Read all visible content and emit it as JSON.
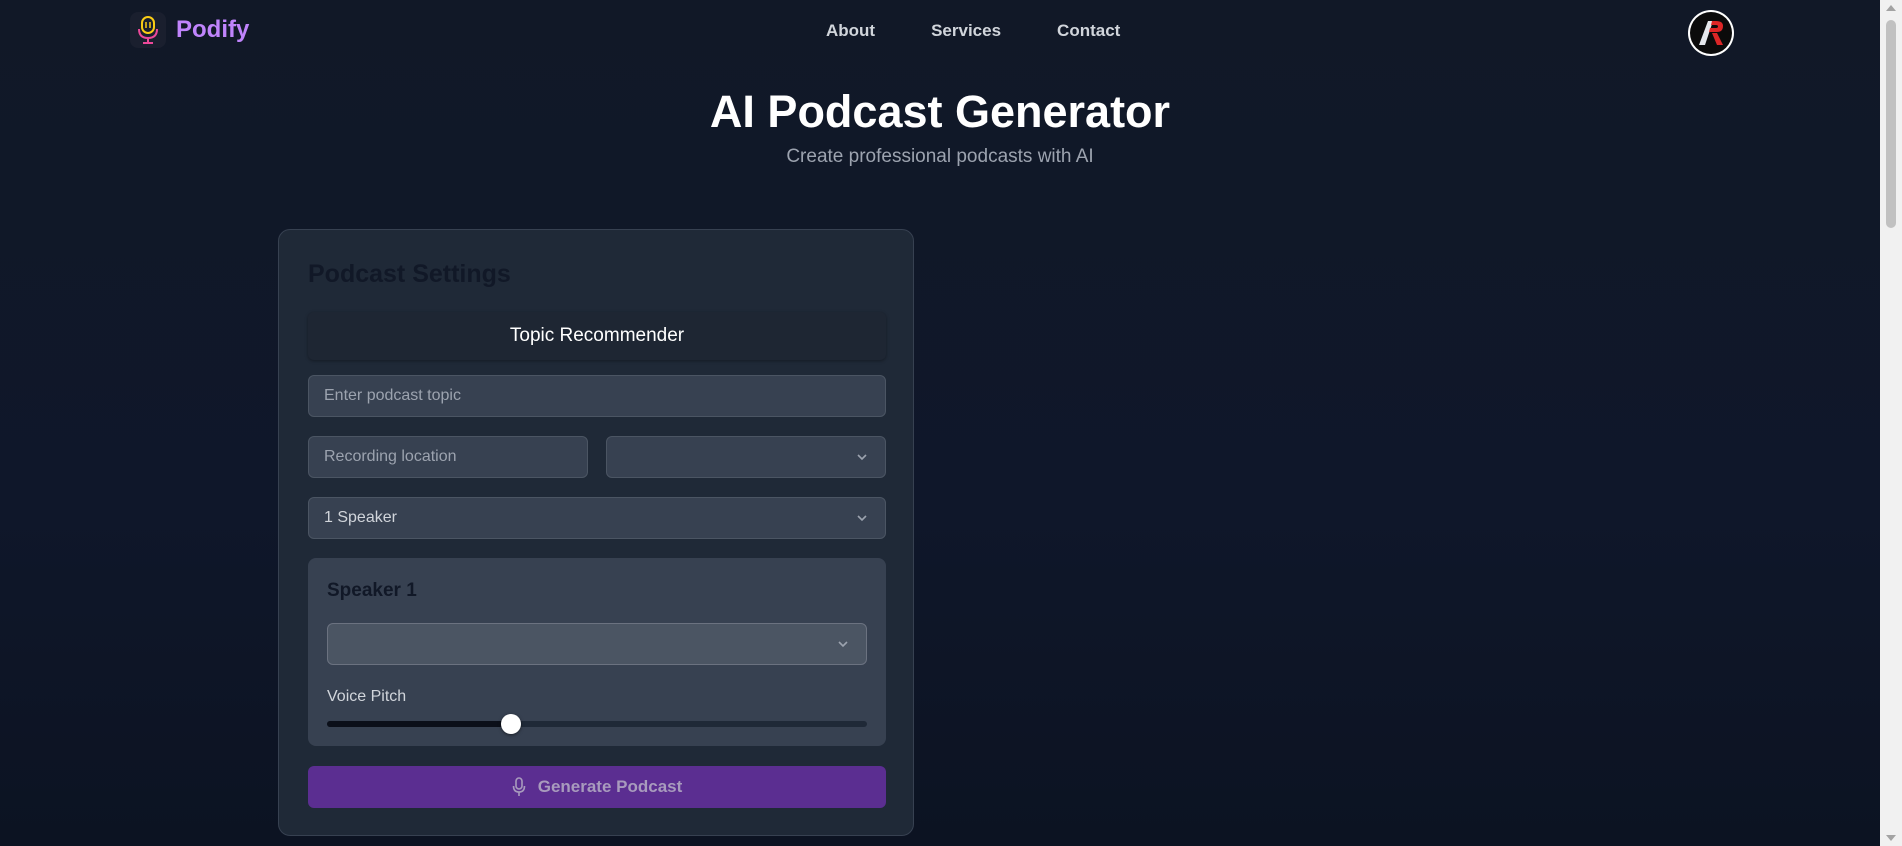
{
  "brand": {
    "name": "Podify",
    "icon": "microphone-icon"
  },
  "nav": {
    "links": [
      "About",
      "Services",
      "Contact"
    ]
  },
  "hero": {
    "title": "AI Podcast Generator",
    "subtitle": "Create professional podcasts with AI"
  },
  "settings": {
    "title": "Podcast Settings",
    "topic_recommender_label": "Topic Recommender",
    "topic_placeholder": "Enter podcast topic",
    "location_placeholder": "Recording location",
    "location_select_value": "",
    "speaker_count_value": "1 Speaker",
    "speaker": {
      "title": "Speaker 1",
      "voice_select_value": "",
      "pitch_label": "Voice Pitch",
      "pitch_level": 0.34
    },
    "generate_label": "Generate Podcast",
    "generate_icon": "microphone-icon"
  },
  "colors": {
    "accent": "#c084fc",
    "button": "#5b2e91",
    "background": "#0f172a"
  }
}
